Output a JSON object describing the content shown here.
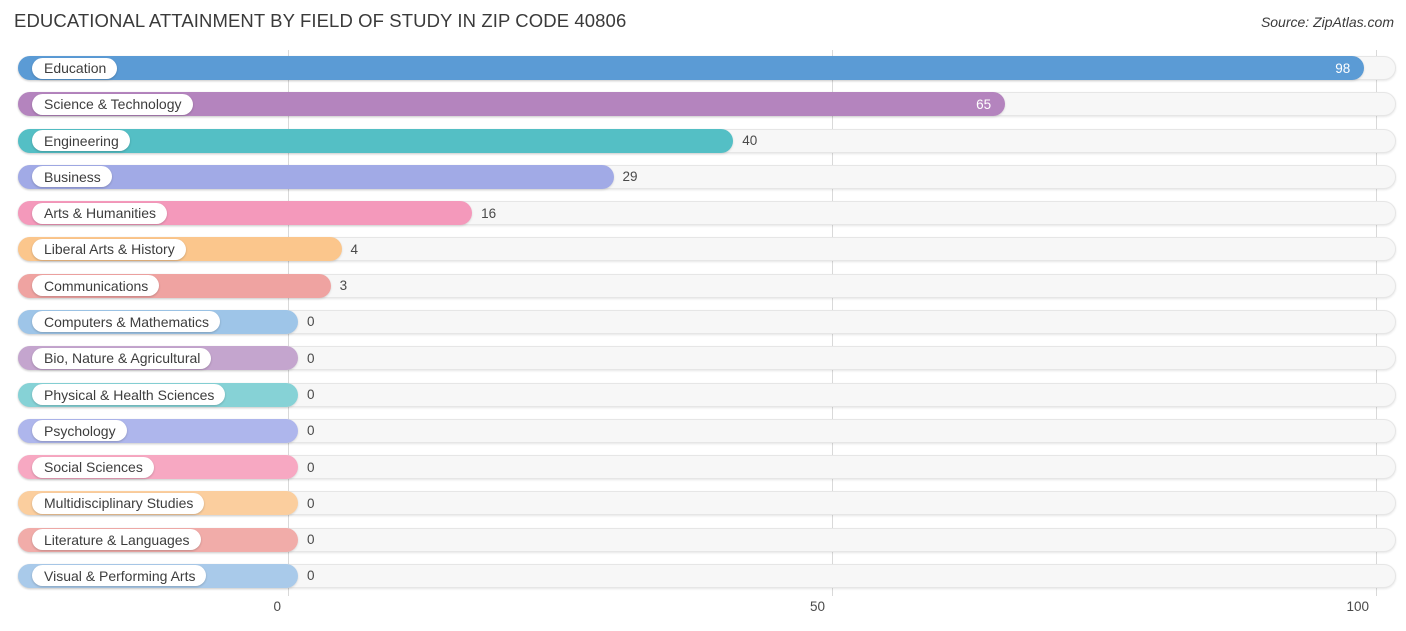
{
  "header": {
    "title": "EDUCATIONAL ATTAINMENT BY FIELD OF STUDY IN ZIP CODE 40806",
    "source": "Source: ZipAtlas.com"
  },
  "chart_data": {
    "type": "bar",
    "orientation": "horizontal",
    "title": "EDUCATIONAL ATTAINMENT BY FIELD OF STUDY IN ZIP CODE 40806",
    "xlabel": "",
    "ylabel": "",
    "xlim": [
      0,
      100
    ],
    "xticks": [
      0,
      50,
      100
    ],
    "xtick_labels": [
      "0",
      "50",
      "100"
    ],
    "grid": true,
    "legend": null,
    "categories": [
      "Education",
      "Science & Technology",
      "Engineering",
      "Business",
      "Arts & Humanities",
      "Liberal Arts & History",
      "Communications",
      "Computers & Mathematics",
      "Bio, Nature & Agricultural",
      "Physical & Health Sciences",
      "Psychology",
      "Social Sciences",
      "Multidisciplinary Studies",
      "Literature & Languages",
      "Visual & Performing Arts"
    ],
    "values": [
      98,
      65,
      40,
      29,
      16,
      4,
      3,
      0,
      0,
      0,
      0,
      0,
      0,
      0,
      0
    ],
    "value_labels": [
      "98",
      "65",
      "40",
      "29",
      "16",
      "4",
      "3",
      "0",
      "0",
      "0",
      "0",
      "0",
      "0",
      "0",
      "0"
    ],
    "colors": [
      "#5b9bd5",
      "#b484be",
      "#54bfc5",
      "#a1aae6",
      "#f499bb",
      "#fbc68c",
      "#efa3a1",
      "#9ec5e8",
      "#c4a5ce",
      "#86d2d6",
      "#aeb6ec",
      "#f7a8c2",
      "#fbce9e",
      "#f1aca9",
      "#a9caea"
    ]
  }
}
